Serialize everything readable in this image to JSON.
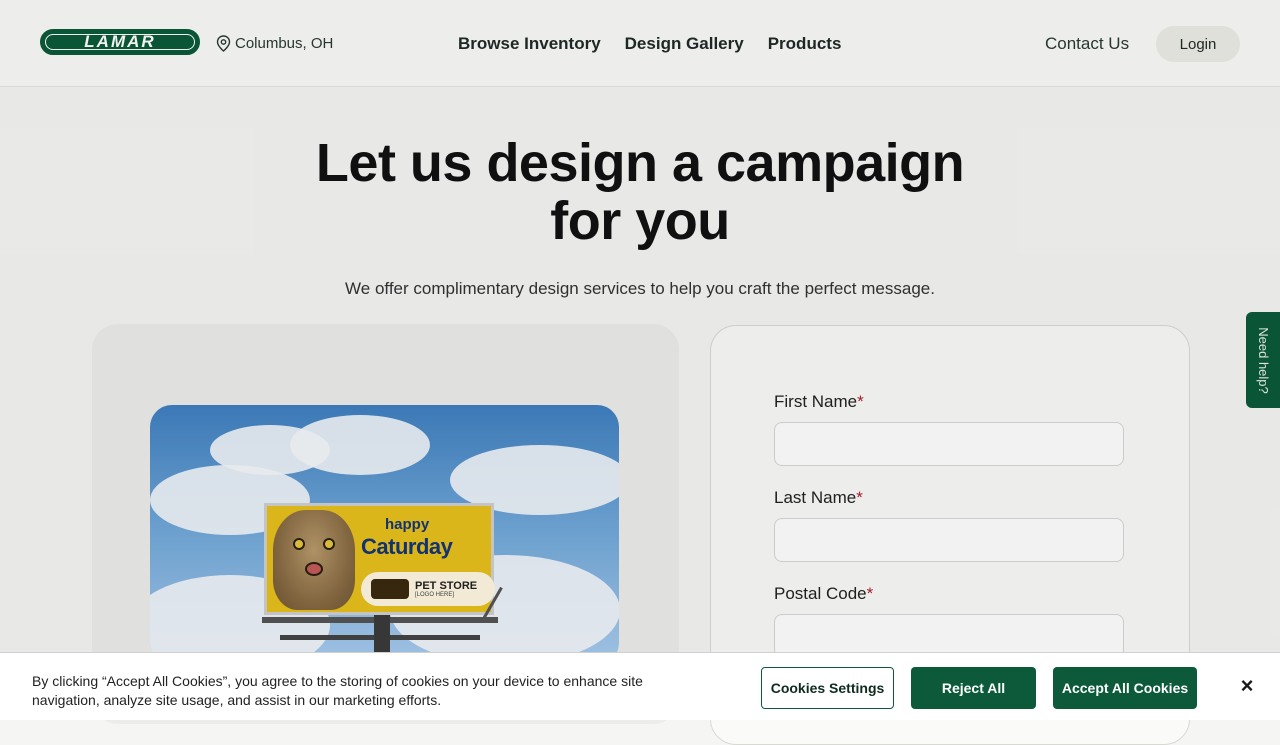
{
  "header": {
    "logo_text": "LAMAR",
    "location": "Columbus, OH",
    "nav": [
      "Browse Inventory",
      "Design Gallery",
      "Products"
    ],
    "contact_label": "Contact Us",
    "login_label": "Login"
  },
  "hero": {
    "title_line1": "Let us design a campaign",
    "title_line2": "for you",
    "subtitle": "We offer complimentary design services to help you craft the perfect message."
  },
  "billboard": {
    "happy": "happy",
    "caturday": "Caturday",
    "store": "PET STORE",
    "store_sub": "[LOGO HERE]"
  },
  "form": {
    "first_name_label": "First Name",
    "last_name_label": "Last Name",
    "postal_code_label": "Postal Code",
    "required_mark": "*",
    "first_name_value": "",
    "last_name_value": "",
    "postal_code_value": ""
  },
  "help_tab": "Need help?",
  "cookie": {
    "text": "By clicking “Accept All Cookies”, you agree to the storing of cookies on your device to enhance site navigation, analyze site usage, and assist in our marketing efforts.",
    "settings_label": "Cookies Settings",
    "reject_label": "Reject All",
    "accept_label": "Accept All Cookies",
    "close_label": "×"
  },
  "colors": {
    "brand_green": "#0c5a3a",
    "required_red": "#b01c2a",
    "background": "#f5f5f3"
  }
}
